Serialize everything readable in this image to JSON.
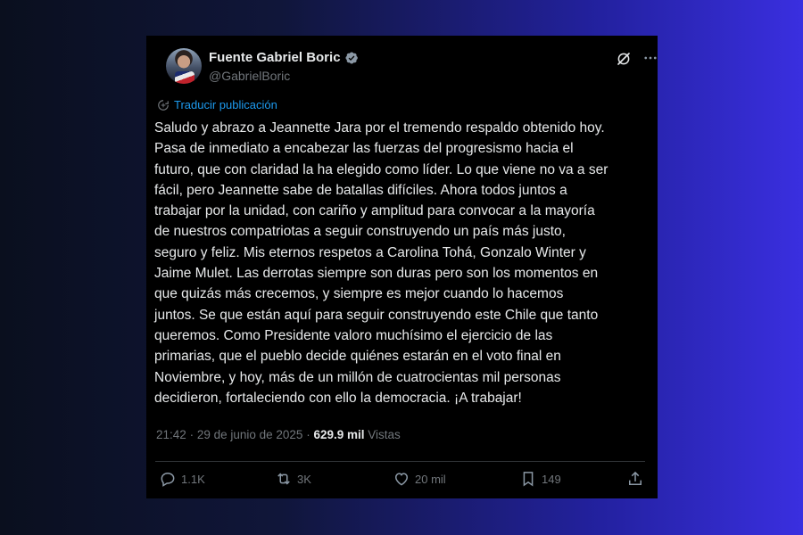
{
  "tweet": {
    "display_name": "Fuente Gabriel Boric",
    "handle": "@GabrielBoric",
    "translate_label": "Traducir publicación",
    "text": "Saludo y abrazo a Jeannette Jara por el tremendo respaldo obtenido hoy.\nPasa de inmediato a encabezar las fuerzas del progresismo hacia el\nfuturo, que con claridad la ha elegido como líder. Lo que viene no va a ser\nfácil, pero Jeannette sabe de batallas difíciles. Ahora todos juntos a\ntrabajar por la unidad, con cariño y amplitud para convocar a la mayoría\nde nuestros compatriotas a seguir construyendo un país más justo,\nseguro y feliz. Mis eternos respetos a Carolina Tohá, Gonzalo Winter y\nJaime Mulet. Las derrotas siempre son duras pero son los momentos en\nque quizás más crecemos, y siempre es mejor cuando lo hacemos\njuntos. Se que están aquí para seguir construyendo este Chile que tanto\nqueremos. Como Presidente valoro muchísimo el ejercicio de las\nprimarias, que el pueblo decide quiénes estarán en el voto final en\nNoviembre, y hoy, más de un millón de cuatrocientas mil personas\ndecidieron, fortaleciendo con ello la democracia. ¡A trabajar!",
    "time": "21:42",
    "separator": "·",
    "date": "29 de junio de 2025",
    "views_count": "629.9 mil",
    "views_label": "Vistas"
  },
  "actions": {
    "replies": "1.1K",
    "reposts": "3K",
    "likes": "20 mil",
    "bookmarks": "149"
  },
  "icons": {
    "verified": "verified-badge-icon",
    "grok": "grok-icon",
    "more": "more-icon",
    "translate": "globe-icon",
    "reply": "reply-icon",
    "repost": "repost-icon",
    "like": "heart-icon",
    "bookmark": "bookmark-icon",
    "share": "share-icon"
  },
  "colors": {
    "card_bg": "#000000",
    "text": "#e7e9ea",
    "secondary": "#71767b",
    "link": "#1d9bf0"
  }
}
